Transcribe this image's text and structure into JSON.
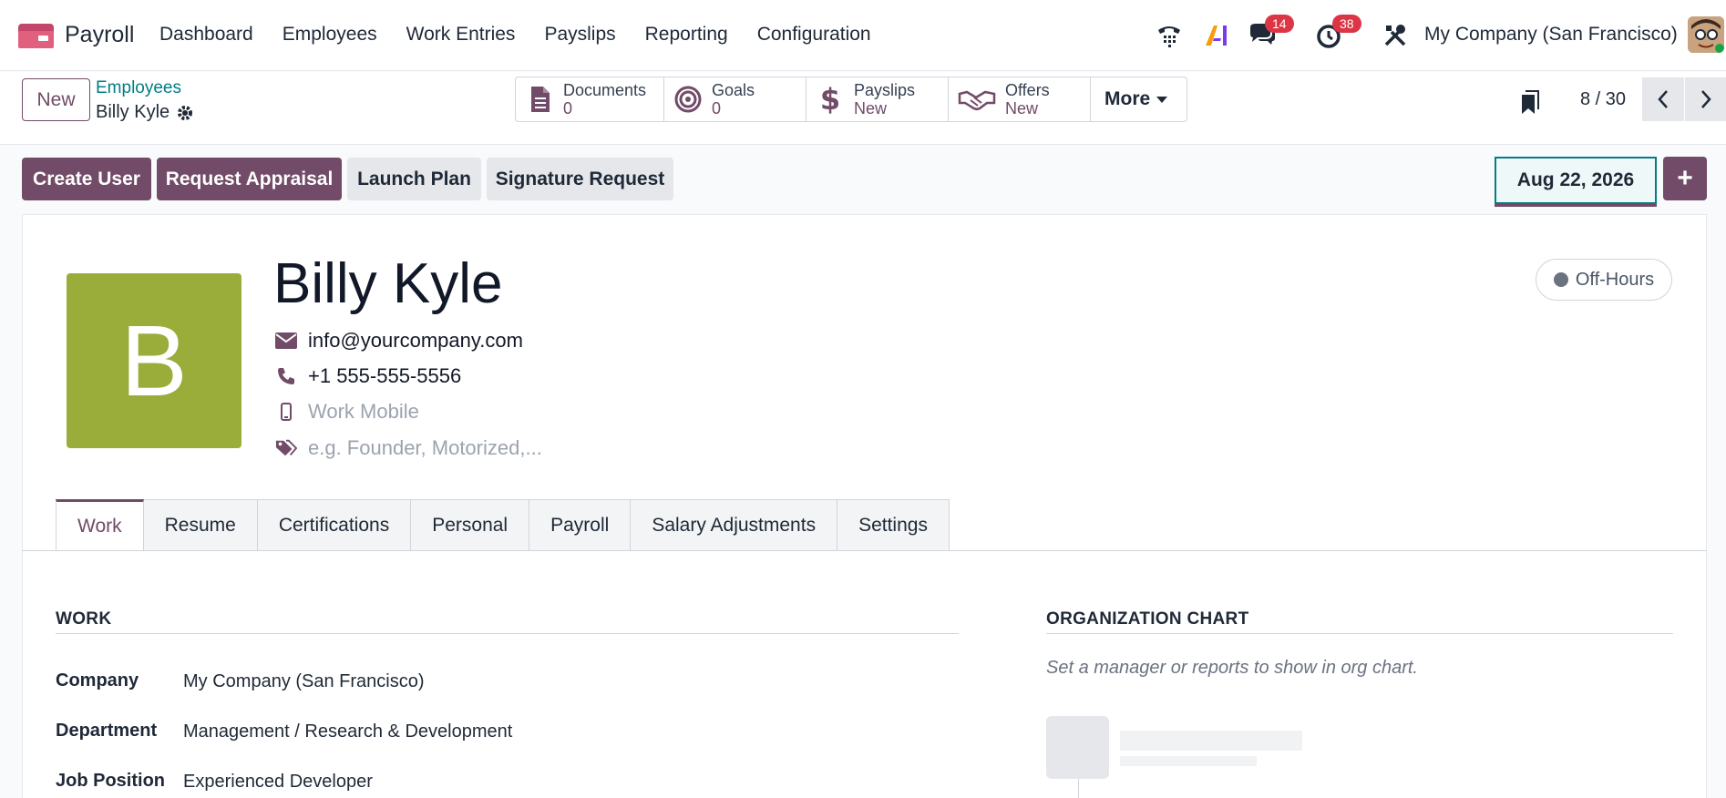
{
  "app": {
    "name": "Payroll",
    "nav": [
      "Dashboard",
      "Employees",
      "Work Entries",
      "Payslips",
      "Reporting",
      "Configuration"
    ],
    "messages_count": "14",
    "activities_count": "38",
    "company": "My Company (San Francisco)"
  },
  "control": {
    "new_label": "New",
    "breadcrumb_parent": "Employees",
    "breadcrumb_current": "Billy Kyle",
    "stats": [
      {
        "label": "Documents",
        "value": "0"
      },
      {
        "label": "Goals",
        "value": "0"
      },
      {
        "label": "Payslips",
        "value": "New"
      },
      {
        "label": "Offers",
        "value": "New"
      }
    ],
    "more_label": "More",
    "pager": "8 / 30"
  },
  "actions": {
    "create_user": "Create User",
    "request_appraisal": "Request Appraisal",
    "launch_plan": "Launch Plan",
    "signature_request": "Signature Request",
    "date": "Aug 22, 2026",
    "plus": "+"
  },
  "employee": {
    "initial": "B",
    "name": "Billy Kyle",
    "email": "info@yourcompany.com",
    "phone": "+1 555-555-5556",
    "mobile_placeholder": "Work Mobile",
    "tags_placeholder": "e.g. Founder, Motorized,...",
    "status": "Off-Hours"
  },
  "tabs": [
    "Work",
    "Resume",
    "Certifications",
    "Personal",
    "Payroll",
    "Salary Adjustments",
    "Settings"
  ],
  "work": {
    "section_title": "WORK",
    "fields": [
      {
        "label": "Company",
        "value": "My Company (San Francisco)"
      },
      {
        "label": "Department",
        "value": "Management / Research & Development"
      },
      {
        "label": "Job Position",
        "value": "Experienced Developer"
      }
    ]
  },
  "org": {
    "section_title": "ORGANIZATION CHART",
    "hint": "Set a manager or reports to show in org chart."
  },
  "colors": {
    "brand": "#714B67",
    "link": "#017e84",
    "avatar_bg": "#9aad3a",
    "badge": "#dc3545"
  }
}
